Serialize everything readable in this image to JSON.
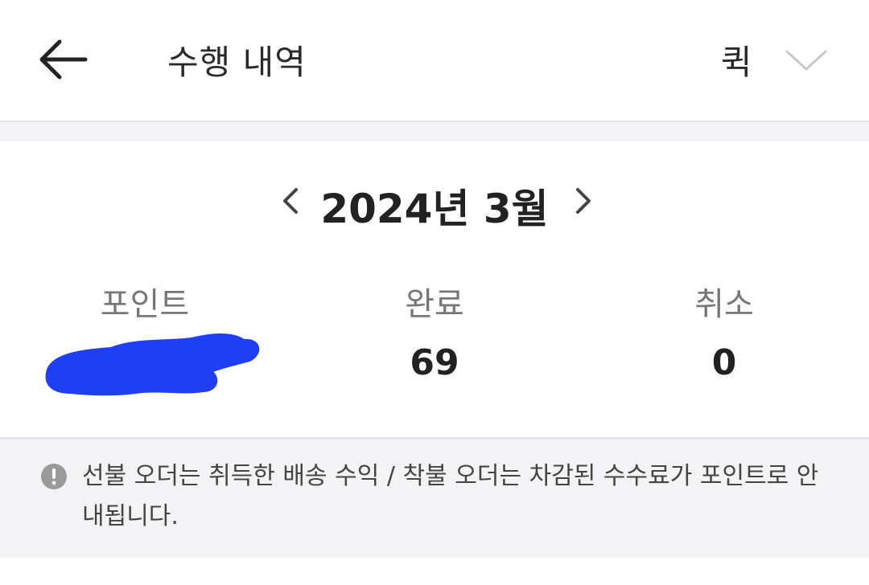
{
  "header": {
    "title": "수행 내역",
    "service": "퀵"
  },
  "month": {
    "label": "2024년 3월"
  },
  "stats": {
    "points": {
      "label": "포인트",
      "value": ""
    },
    "completed": {
      "label": "완료",
      "value": "69"
    },
    "cancelled": {
      "label": "취소",
      "value": "0"
    }
  },
  "notice": {
    "text": "선불 오더는 취득한 배송 수익 / 착불 오더는 차감된 수수료가 포인트로 안내됩니다."
  },
  "colors": {
    "redaction": "#1f3ff5",
    "notice_bg": "#f3f3f5",
    "info_icon": "#9a9a9a"
  }
}
